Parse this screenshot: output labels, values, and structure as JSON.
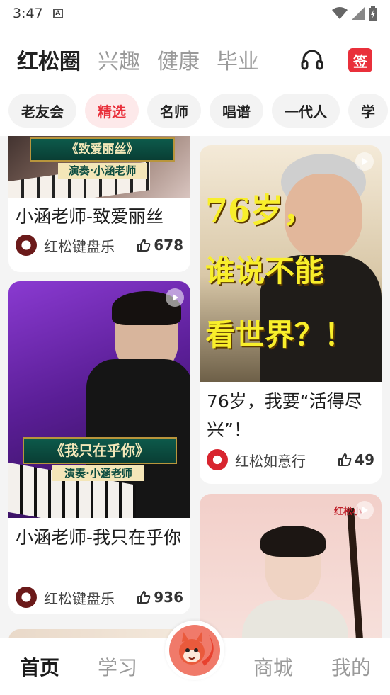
{
  "status_bar": {
    "time": "3:47",
    "notif_icon": "a-icon"
  },
  "top_tabs": [
    {
      "label": "红松圈",
      "active": true
    },
    {
      "label": "兴趣",
      "active": false
    },
    {
      "label": "健康",
      "active": false
    },
    {
      "label": "毕业",
      "active": false
    }
  ],
  "header_icons": {
    "support": "headset-icon",
    "sign_in": "签"
  },
  "chips": [
    {
      "label": "老友会",
      "active": false
    },
    {
      "label": "精选",
      "active": true
    },
    {
      "label": "名师",
      "active": false
    },
    {
      "label": "唱谱",
      "active": false
    },
    {
      "label": "一代人",
      "active": false
    },
    {
      "label": "学",
      "active": false
    }
  ],
  "feed": {
    "left": [
      {
        "title": "小涵老师-致爱丽丝",
        "author": "红松键盘乐",
        "likes": "678",
        "banner": "《致爱丽丝》",
        "sub_banner": "演奏·小涵老师"
      },
      {
        "title": "小涵老师-我只在乎你",
        "author": "红松键盘乐",
        "likes": "936",
        "banner": "《我只在乎你》",
        "sub_banner": "演奏·小涵老师"
      }
    ],
    "right": [
      {
        "title": "76岁，我要“活得尽兴”！",
        "author": "红松如意行",
        "likes": "49",
        "overlay": [
          "76岁，",
          "谁说不能",
          "看世界？！"
        ]
      },
      {
        "logo_text": "红松小"
      }
    ]
  },
  "bottom_nav": [
    {
      "label": "首页",
      "active": true
    },
    {
      "label": "学习",
      "active": false
    },
    {
      "label": "商城",
      "active": false
    },
    {
      "label": "我的",
      "active": false
    }
  ],
  "colors": {
    "accent": "#e9303b",
    "chip_active_bg": "#fde9ea"
  }
}
